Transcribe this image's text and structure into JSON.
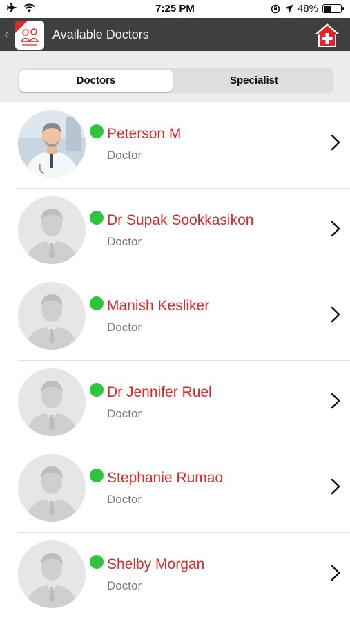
{
  "status_bar": {
    "time": "7:25 PM",
    "battery_percent": "48%",
    "battery_level": 0.48,
    "icons": [
      "airplane-icon",
      "wifi-icon",
      "orientation-lock-icon",
      "location-icon",
      "battery-icon"
    ]
  },
  "nav": {
    "title": "Available Doctors",
    "back_icon": "chevron-left-icon",
    "home_icon": "home-medical-icon"
  },
  "tabs": [
    {
      "label": "Doctors",
      "selected": true
    },
    {
      "label": "Specialist",
      "selected": false
    }
  ],
  "doctors": [
    {
      "name": "Peterson M",
      "role": "Doctor",
      "online": true,
      "photo": "doctor-photo"
    },
    {
      "name": "Dr Supak Sookkasikon",
      "role": "Doctor",
      "online": true,
      "photo": "placeholder-avatar"
    },
    {
      "name": "Manish Kesliker",
      "role": "Doctor",
      "online": true,
      "photo": "placeholder-avatar"
    },
    {
      "name": "Dr Jennifer Ruel",
      "role": "Doctor",
      "online": true,
      "photo": "placeholder-avatar"
    },
    {
      "name": "Stephanie Rumao",
      "role": "Doctor",
      "online": true,
      "photo": "placeholder-avatar"
    },
    {
      "name": "Shelby Morgan",
      "role": "Doctor",
      "online": true,
      "photo": "placeholder-avatar"
    }
  ],
  "colors": {
    "nav_bg": "#3f3f3f",
    "name_red": "#d62b2b",
    "online_green": "#2fc43b",
    "role_gray": "#7a7a7a"
  }
}
